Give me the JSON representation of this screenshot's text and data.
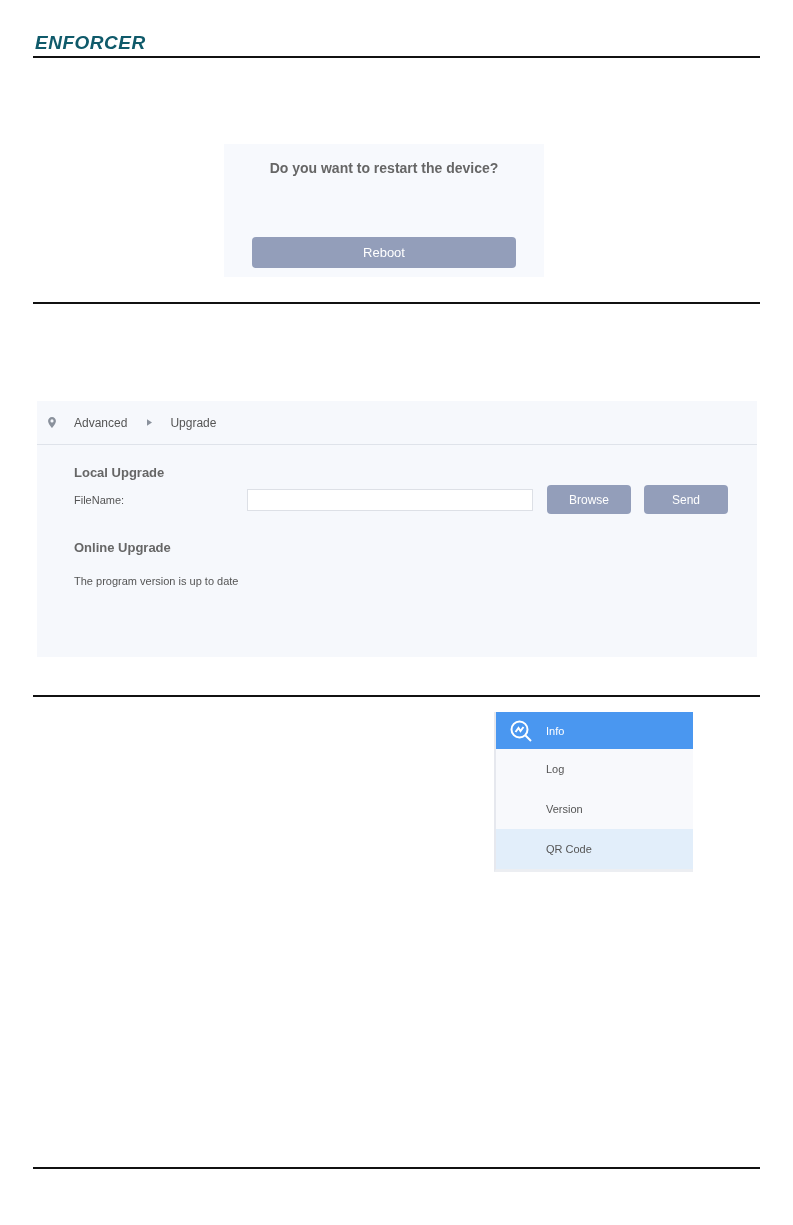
{
  "header": {
    "logo": "ENFORCER"
  },
  "reboot_dialog": {
    "question": "Do you want to restart the device?",
    "button": "Reboot"
  },
  "upgrade_panel": {
    "breadcrumb": [
      "Advanced",
      "Upgrade"
    ],
    "local_upgrade": {
      "title": "Local Upgrade",
      "label": "FileName:",
      "buttons": [
        "Browse",
        "Send"
      ]
    },
    "online_upgrade": {
      "title": "Online Upgrade",
      "status": "The program version is up to date"
    }
  },
  "menu": {
    "items": [
      {
        "label": "Info",
        "selected": true,
        "hovered": false,
        "icon": true
      },
      {
        "label": "Log",
        "selected": false,
        "hovered": false,
        "icon": false
      },
      {
        "label": "Version",
        "selected": false,
        "hovered": false,
        "icon": false
      },
      {
        "label": "QR Code",
        "selected": false,
        "hovered": true,
        "icon": false
      }
    ]
  }
}
